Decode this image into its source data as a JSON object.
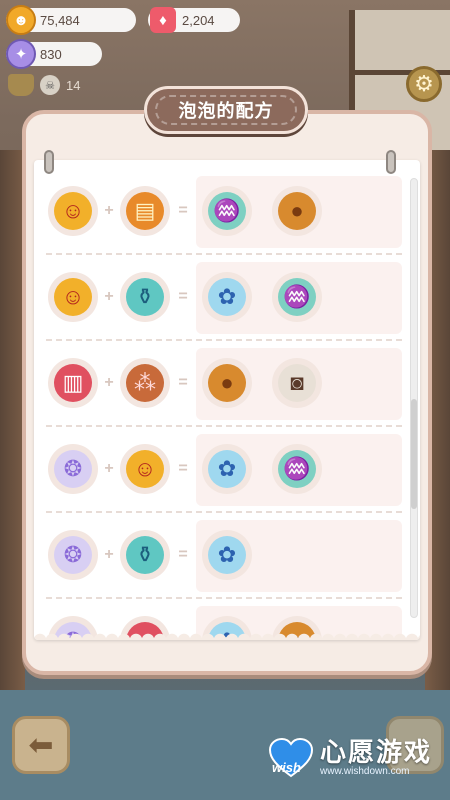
{
  "hud": {
    "coins": "75,484",
    "gems": "2,204",
    "orbs": "830",
    "skull_count": "14"
  },
  "panel": {
    "title": "泡泡的配方"
  },
  "operators": {
    "plus": "+",
    "equals": "="
  },
  "recipes": [
    {
      "inputs": [
        "mr-tomato-boxer",
        "orange-backpack"
      ],
      "outputs": [
        "rainbow-bottle",
        "cookie"
      ]
    },
    {
      "inputs": [
        "mr-tomato-boxer",
        "teal-flask"
      ],
      "outputs": [
        "blue-bubble-sack",
        "rainbow-bottle"
      ]
    },
    {
      "inputs": [
        "chattering-teeth",
        "bean-sack"
      ],
      "outputs": [
        "cookie",
        "milk-jar"
      ]
    },
    {
      "inputs": [
        "rainbow-shell",
        "mr-tomato-boxer"
      ],
      "outputs": [
        "blue-bubble-sack",
        "rainbow-bottle"
      ]
    },
    {
      "inputs": [
        "rainbow-shell",
        "teal-flask"
      ],
      "outputs": [
        "blue-bubble-sack"
      ]
    },
    {
      "inputs": [
        "rainbow-shell",
        "red-item"
      ],
      "outputs": [
        "blue-bubble-sack",
        "cookie"
      ]
    }
  ],
  "watermark": {
    "brand": "wish",
    "name": "心愿游戏",
    "url": "www.wishdown.com"
  },
  "colors": {
    "panel_bg": "#f6ece5",
    "panel_border": "#d9b6a6",
    "title_tab": "#8c6a5c",
    "row_highlight": "#fbf1ef",
    "coin": "#f1a929",
    "gem": "#ee5b6b",
    "orb": "#a78ee6"
  },
  "icons": {
    "coin": "coin-icon",
    "gem": "gem-icon",
    "orb": "orb-icon",
    "bell": "bell-icon",
    "skull": "skull-icon",
    "settings": "gear-icon",
    "back": "back-arrow-icon"
  },
  "scrollbar": {
    "position": 0.67
  }
}
